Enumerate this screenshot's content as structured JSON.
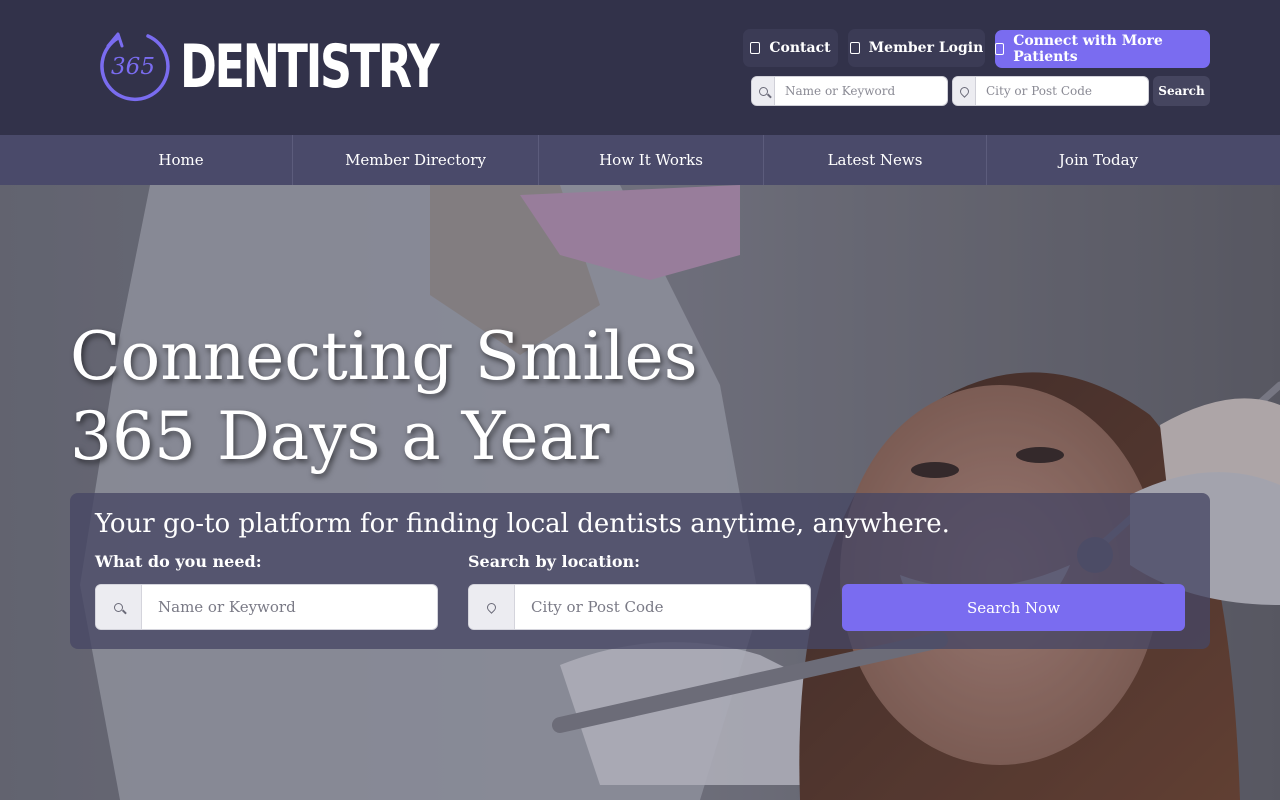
{
  "brand": {
    "logo_number": "365",
    "logo_word": "DENTISTRY",
    "accent_color": "#7a6cf0",
    "header_bg": "#32324a",
    "nav_bg": "#4a4a6a"
  },
  "header": {
    "contact_label": "Contact",
    "contact_icon": "envelope-icon",
    "login_label": "Member Login",
    "login_icon": "user-icon",
    "connect_label": "Connect with More Patients",
    "connect_icon": "user-plus-icon",
    "keyword_placeholder": "Name or Keyword",
    "location_placeholder": "City or Post Code",
    "search_label": "Search"
  },
  "nav": {
    "items": [
      {
        "label": "Home"
      },
      {
        "label": "Member Directory"
      },
      {
        "label": "How It Works"
      },
      {
        "label": "Latest News"
      },
      {
        "label": "Join Today"
      }
    ]
  },
  "hero": {
    "title": "Connecting Smiles 365 Days a Year",
    "subtitle": "Your go-to platform for finding local dentists anytime, anywhere.",
    "need_label": "What do you need:",
    "location_label": "Search by location:",
    "keyword_placeholder": "Name or Keyword",
    "location_placeholder": "City or Post Code",
    "search_button": "Search Now"
  }
}
